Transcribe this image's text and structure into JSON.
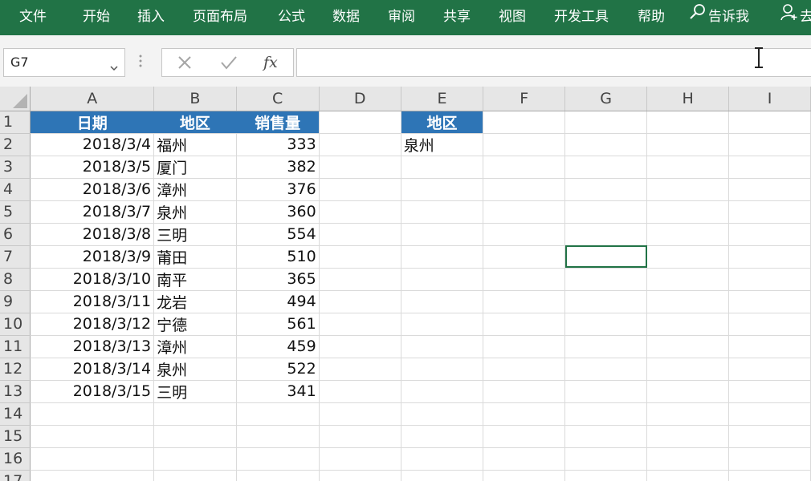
{
  "ribbon": {
    "tabs": [
      "文件",
      "开始",
      "插入",
      "页面布局",
      "公式",
      "数据",
      "审阅",
      "共享",
      "视图",
      "开发工具",
      "帮助"
    ],
    "tell_me": "告诉我",
    "share_partial": "去"
  },
  "formula_bar": {
    "name_box": "G7",
    "fx": "fx",
    "formula": ""
  },
  "columns": [
    "A",
    "B",
    "C",
    "D",
    "E",
    "F",
    "G",
    "H",
    "I"
  ],
  "rows": [
    {
      "n": "1",
      "a": "日期",
      "b": "地区",
      "c": "销售量",
      "e": "地区"
    },
    {
      "n": "2",
      "a": "2018/3/4",
      "b": "福州",
      "c": "333",
      "e": "泉州"
    },
    {
      "n": "3",
      "a": "2018/3/5",
      "b": "厦门",
      "c": "382",
      "e": ""
    },
    {
      "n": "4",
      "a": "2018/3/6",
      "b": "漳州",
      "c": "376",
      "e": ""
    },
    {
      "n": "5",
      "a": "2018/3/7",
      "b": "泉州",
      "c": "360",
      "e": ""
    },
    {
      "n": "6",
      "a": "2018/3/8",
      "b": "三明",
      "c": "554",
      "e": ""
    },
    {
      "n": "7",
      "a": "2018/3/9",
      "b": "莆田",
      "c": "510",
      "e": ""
    },
    {
      "n": "8",
      "a": "2018/3/10",
      "b": "南平",
      "c": "365",
      "e": ""
    },
    {
      "n": "9",
      "a": "2018/3/11",
      "b": "龙岩",
      "c": "494",
      "e": ""
    },
    {
      "n": "10",
      "a": "2018/3/12",
      "b": "宁德",
      "c": "561",
      "e": ""
    },
    {
      "n": "11",
      "a": "2018/3/13",
      "b": "漳州",
      "c": "459",
      "e": ""
    },
    {
      "n": "12",
      "a": "2018/3/14",
      "b": "泉州",
      "c": "522",
      "e": ""
    },
    {
      "n": "13",
      "a": "2018/3/15",
      "b": "三明",
      "c": "341",
      "e": ""
    },
    {
      "n": "14",
      "a": "",
      "b": "",
      "c": "",
      "e": ""
    },
    {
      "n": "15",
      "a": "",
      "b": "",
      "c": "",
      "e": ""
    },
    {
      "n": "16",
      "a": "",
      "b": "",
      "c": "",
      "e": ""
    },
    {
      "n": "17",
      "a": "",
      "b": "",
      "c": "",
      "e": ""
    }
  ],
  "colors": {
    "ribbon": "#217346",
    "header_fill": "#2e75b6",
    "header_text": "#ffffff"
  },
  "icons": {
    "tell_me": "search-icon",
    "share": "person-add-icon",
    "name_box_dropdown": "chevron-down-icon",
    "cancel": "close-icon",
    "enter": "check-icon",
    "cursor": "text-cursor-icon"
  }
}
